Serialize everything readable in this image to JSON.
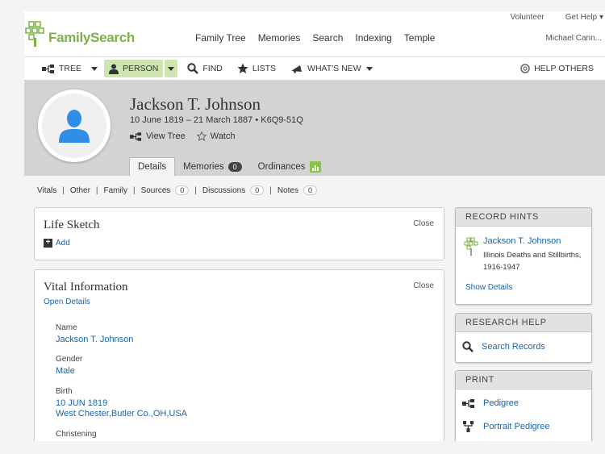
{
  "header": {
    "logo_text": "FamilySearch",
    "nav": [
      "Family Tree",
      "Memories",
      "Search",
      "Indexing",
      "Temple"
    ],
    "top_links": [
      "Volunteer",
      "Get Help ▾"
    ],
    "user_name": "Michael Cann..."
  },
  "toolbar": {
    "tree": "TREE",
    "person": "PERSON",
    "find": "FIND",
    "lists": "LISTS",
    "whats_new": "WHAT'S NEW",
    "help_others": "HELP OTHERS"
  },
  "person": {
    "name": "Jackson T. Johnson",
    "dates_id": "10 June 1819 – 21 March 1887 • K6Q9-51Q",
    "view_tree": "View Tree",
    "watch": "Watch"
  },
  "tabs": {
    "details": "Details",
    "memories": "Memories",
    "memories_count": "0",
    "ordinances": "Ordinances"
  },
  "subnav": {
    "vitals": "Vitals",
    "other": "Other",
    "family": "Family",
    "sources": "Sources",
    "sources_count": "0",
    "discussions": "Discussions",
    "discussions_count": "0",
    "notes": "Notes",
    "notes_count": "0"
  },
  "life_sketch": {
    "title": "Life Sketch",
    "close": "Close",
    "add": "Add"
  },
  "vital_info": {
    "title": "Vital Information",
    "close": "Close",
    "open_details": "Open Details",
    "name_label": "Name",
    "name_value": "Jackson T. Johnson",
    "gender_label": "Gender",
    "gender_value": "Male",
    "birth_label": "Birth",
    "birth_date": "10 JUN 1819",
    "birth_place": "West Chester,Butler Co.,OH,USA",
    "christening_label": "Christening"
  },
  "record_hints": {
    "title": "RECORD HINTS",
    "hint_name": "Jackson T. Johnson",
    "hint_collection": "Illinois Deaths and Stillbirths, 1916-1947",
    "show_details": "Show Details"
  },
  "research_help": {
    "title": "RESEARCH HELP",
    "search_records": "Search Records"
  },
  "print": {
    "title": "PRINT",
    "pedigree": "Pedigree",
    "portrait_pedigree": "Portrait Pedigree"
  },
  "colors": {
    "brand_green": "#7ab342",
    "link_blue": "#1a64aa",
    "person_highlight": "#cfe5b0",
    "avatar_blue": "#2f8ee6"
  }
}
